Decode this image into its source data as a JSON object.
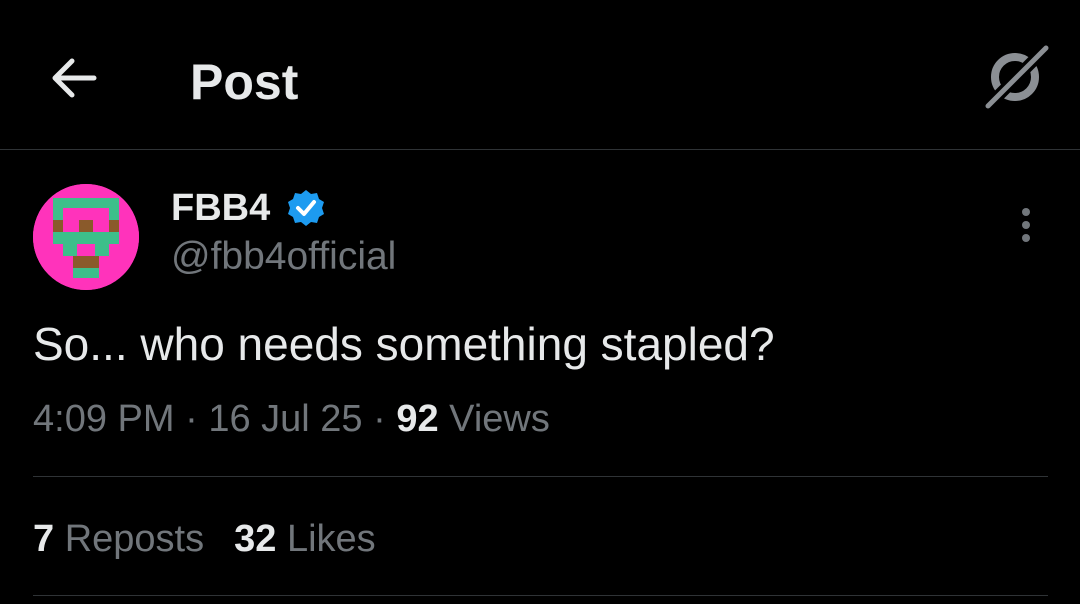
{
  "header": {
    "title": "Post",
    "back_icon": "arrow-left-icon",
    "grok_icon": "grok-icon"
  },
  "post": {
    "author": {
      "name": "FBB4",
      "handle": "@fbb4official",
      "verified": true,
      "verified_color": "#1d9bf0",
      "avatar_colors": [
        "#ff33bb",
        "#3dbf8a",
        "#8a5a2b"
      ]
    },
    "text": "So... who needs something stapled?",
    "time": "4:09 PM",
    "date": "16 Jul 25",
    "separator": "·",
    "views_count": "92",
    "views_label": "Views",
    "more_icon": "more-vertical-icon"
  },
  "stats": {
    "reposts_count": "7",
    "reposts_label": "Reposts",
    "likes_count": "32",
    "likes_label": "Likes"
  },
  "colors": {
    "background": "#000000",
    "text_primary": "#e7e9ea",
    "text_secondary": "#71767b",
    "divider": "#2f3336"
  }
}
